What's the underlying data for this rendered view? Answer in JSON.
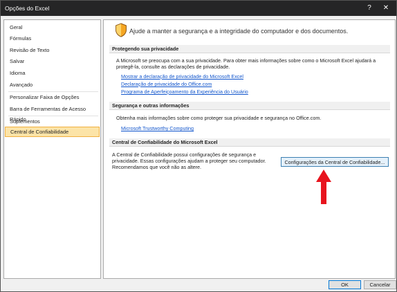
{
  "window": {
    "title": "Opções do Excel",
    "help_glyph": "?",
    "close_glyph": "✕"
  },
  "sidebar": {
    "items": [
      {
        "label": "Geral"
      },
      {
        "label": "Fórmulas"
      },
      {
        "label": "Revisão de Texto"
      },
      {
        "label": "Salvar"
      },
      {
        "label": "Idioma"
      },
      {
        "label": "Avançado"
      },
      {
        "label": "Personalizar Faixa de Opções"
      },
      {
        "label": "Barra de Ferramentas de Acesso Rápido"
      },
      {
        "label": "Suplementos"
      },
      {
        "label": "Central de Confiabilidade",
        "selected": true
      }
    ]
  },
  "main": {
    "intro": "Ajude a manter a segurança e a integridade do computador e dos documentos.",
    "privacy": {
      "header": "Protegendo sua privacidade",
      "text_line1": "A Microsoft se preocupa com a sua privacidade. Para obter mais informações sobre como o Microsoft Excel ajudará a",
      "text_line2": "protegê-la, consulte as declarações de privacidade.",
      "links": [
        "Mostrar a declaração de privacidade do Microsoft Excel",
        "Declaração de privacidade do Office.com",
        "Programa de Aperfeiçoamento da Experiência do Usuário"
      ]
    },
    "security": {
      "header": "Segurança e outras informações",
      "text": "Obtenha mais informações sobre como proteger sua privacidade e segurança no Office.com.",
      "link": "Microsoft Trustworthy Computing"
    },
    "trust_center": {
      "header": "Central de Confiabilidade do Microsoft Excel",
      "text_line1": "A Central de Confiabilidade possui configurações de segurança e",
      "text_line2": "privacidade. Essas configurações ajudam a proteger seu computador.",
      "text_line3": "Recomendamos que você não as altere.",
      "button": "Configurações da Central de Confiabilidade..."
    }
  },
  "footer": {
    "ok": "OK",
    "cancel": "Cancelar"
  },
  "colors": {
    "selected_bg": "#fce4a8",
    "selected_border": "#f0b040",
    "link": "#1155cc",
    "arrow": "#e8141e",
    "titlebar": "#252526"
  },
  "icons": {
    "shield": "shield-icon",
    "arrow": "red-arrow-up-icon"
  }
}
